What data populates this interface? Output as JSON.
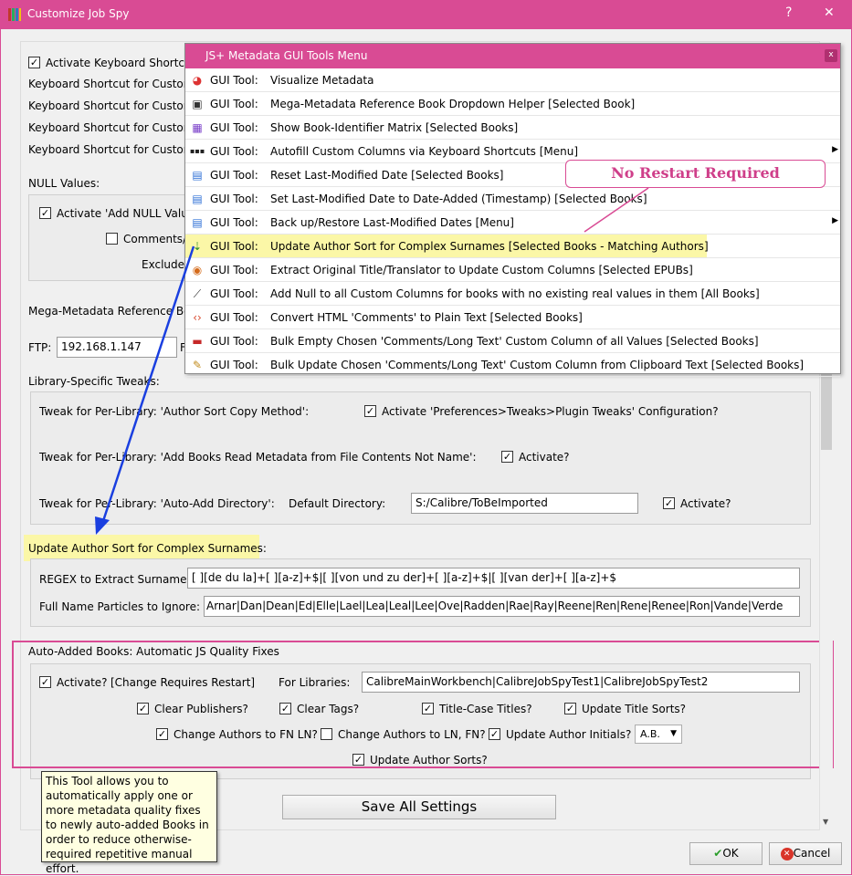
{
  "window": {
    "title": "Customize Job Spy",
    "help": "?",
    "close": "✕"
  },
  "shortcuts": {
    "activate_label": "Activate Keyboard Shortcut",
    "rows": [
      "Keyboard Shortcut for Custom",
      "Keyboard Shortcut for Custom",
      "Keyboard Shortcut for Custom",
      "Keyboard Shortcut for Custom"
    ]
  },
  "null_values": {
    "header": "NULL Values:",
    "activate_label": "Activate 'Add NULL Value",
    "comments_label": "Comments/",
    "exclude_label": "Exclude"
  },
  "mega": {
    "label": "Mega-Metadata Reference Boo",
    "ftp_label": "FTP:",
    "ftp_value": "192.168.1.147",
    "trail": "F"
  },
  "library_tweaks": {
    "header": "Library-Specific Tweaks:",
    "tweak1_label": "Tweak for Per-Library: 'Author Sort Copy Method':",
    "tweak1_check": "Activate 'Preferences>Tweaks>Plugin Tweaks' Configuration?",
    "tweak2_label": "Tweak for Per-Library: 'Add Books Read Metadata from File Contents Not Name':",
    "tweak2_check": "Activate?",
    "tweak3_label": "Tweak for Per-Library: 'Auto-Add Directory':",
    "default_dir_label": "Default Directory:",
    "default_dir_value": "S:/Calibre/ToBeImported",
    "tweak3_check": "Activate?"
  },
  "author_sort": {
    "header": "Update Author Sort for Complex Surnames:",
    "regex_label": "REGEX to Extract Surname:",
    "regex_value": "[ ][de du la]+[ ][a-z]+$|[ ][von und zu der]+[ ][a-z]+$|[ ][van der]+[ ][a-z]+$",
    "particles_label": "Full Name Particles to Ignore:",
    "particles_value": "Arnar|Dan|Dean|Ed|Elle|Lael|Lea|Leal|Lee|Ove|Radden|Rae|Ray|Reene|Ren|Rene|Renee|Ron|Vande|Verde"
  },
  "auto_added": {
    "header": "Auto-Added Books: Automatic JS Quality Fixes",
    "activate_label": "Activate?",
    "restart_note": "[Change Requires Restart]",
    "libraries_label": "For Libraries:",
    "libraries_value": "CalibreMainWorkbench|CalibreJobSpyTest1|CalibreJobSpyTest2",
    "clear_publishers": "Clear Publishers?",
    "clear_tags": "Clear Tags?",
    "title_case": "Title-Case Titles?",
    "update_title_sorts": "Update Title Sorts?",
    "authors_fn_ln": "Change Authors to FN LN?",
    "authors_ln_fn": "Change Authors to LN, FN?",
    "author_initials": "Update Author Initials?",
    "initials_value": "A.B.",
    "update_author_sorts": "Update Author Sorts?"
  },
  "tooltip": "This Tool allows you to automatically apply one or more metadata quality fixes to newly auto-added Books in order to reduce otherwise-required repetitive manual effort.",
  "buttons": {
    "save_all": "Save All Settings",
    "ok": "OK",
    "cancel": "Cancel"
  },
  "menu": {
    "title": "JS+ Metadata GUI Tools Menu",
    "close": "x",
    "prefix": "GUI Tool:",
    "items": [
      {
        "label": "Visualize Metadata",
        "icon": "pie-chart-icon"
      },
      {
        "label": "Mega-Metadata Reference Book Dropdown Helper [Selected Book]",
        "icon": "monitor-icon"
      },
      {
        "label": "Show Book-Identifier Matrix [Selected Books]",
        "icon": "grid-icon"
      },
      {
        "label": "Autofill Custom Columns via Keyboard Shortcuts [Menu]",
        "icon": "keyboard-icon"
      },
      {
        "label": "Reset Last-Modified Date [Selected Books]",
        "icon": "calendar-icon"
      },
      {
        "label": "Set Last-Modified Date to Date-Added (Timestamp) [Selected Books]",
        "icon": "calendar-icon"
      },
      {
        "label": "Back up/Restore Last-Modified Dates [Menu]",
        "icon": "calendar-icon"
      },
      {
        "label": "Update Author Sort for Complex Surnames [Selected Books - Matching Authors]",
        "icon": "sort-icon"
      },
      {
        "label": "Extract Original Title/Translator to Update Custom Columns [Selected EPUBs]",
        "icon": "colorwheel-icon"
      },
      {
        "label": "Add Null to all Custom Columns for books with no existing real values in them [All Books]",
        "icon": "wand-icon"
      },
      {
        "label": "Convert HTML 'Comments' to Plain Text [Selected Books]",
        "icon": "code-icon"
      },
      {
        "label": "Bulk Empty Chosen 'Comments/Long Text' Custom Column of all Values [Selected Books]",
        "icon": "eraser-icon"
      },
      {
        "label": "Bulk Update Chosen 'Comments/Long Text' Custom Column from Clipboard Text [Selected Books]",
        "icon": "pencil-icon"
      }
    ]
  },
  "callout": "No Restart Required",
  "colors": {
    "accent": "#d94b94",
    "highlight": "#fbf7a7",
    "arrow": "#1a3fe0"
  }
}
